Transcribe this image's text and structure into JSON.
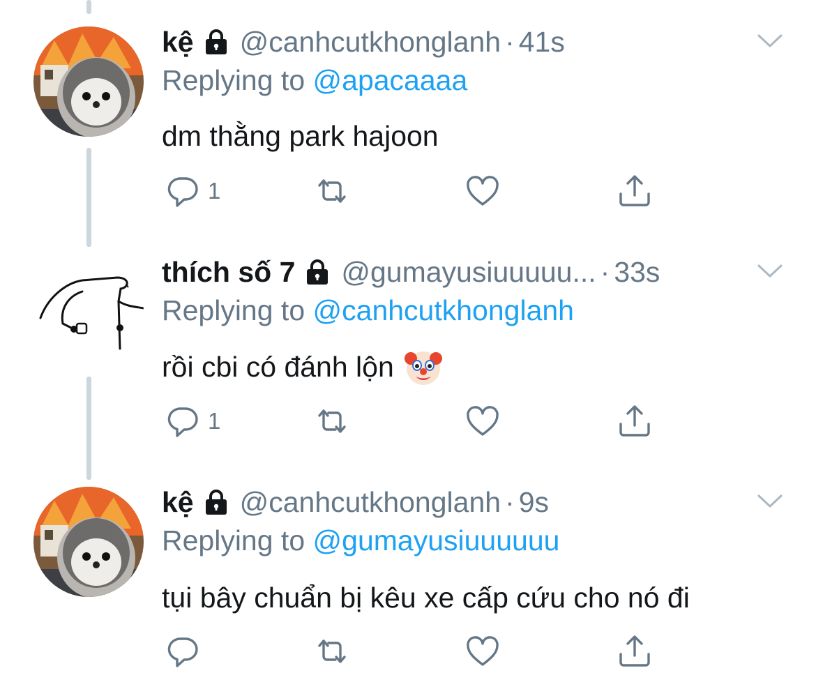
{
  "colors": {
    "link": "#1da1f2",
    "muted": "#657786",
    "text": "#14171a",
    "thread_line": "#ccd6dd"
  },
  "tweets": [
    {
      "name": "kệ",
      "protected_icon": "lock-icon",
      "handle": "@canhcutkhonglanh",
      "separator": "·",
      "time": "41s",
      "replying_prefix": "Replying to",
      "replying_to": "@apacaaaa",
      "text": "dm thằng park hajoon",
      "reply_count": "1",
      "avatar": "penguin-avatar"
    },
    {
      "name": "thích số 7",
      "protected_icon": "lock-icon",
      "handle": "@gumayusiuuuuu...",
      "separator": "·",
      "time": "33s",
      "replying_prefix": "Replying to",
      "replying_to": "@canhcutkhonglanh",
      "text": "rồi cbi có đánh lộn",
      "emoji": "clown-face-emoji",
      "reply_count": "1",
      "avatar": "doodle-avatar"
    },
    {
      "name": "kệ",
      "protected_icon": "lock-icon",
      "handle": "@canhcutkhonglanh",
      "separator": "·",
      "time": "9s",
      "replying_prefix": "Replying to",
      "replying_to": "@gumayusiuuuuuu",
      "text": "tụi bây chuẩn bị kêu xe cấp cứu cho nó đi",
      "reply_count": "",
      "avatar": "penguin-avatar"
    }
  ]
}
